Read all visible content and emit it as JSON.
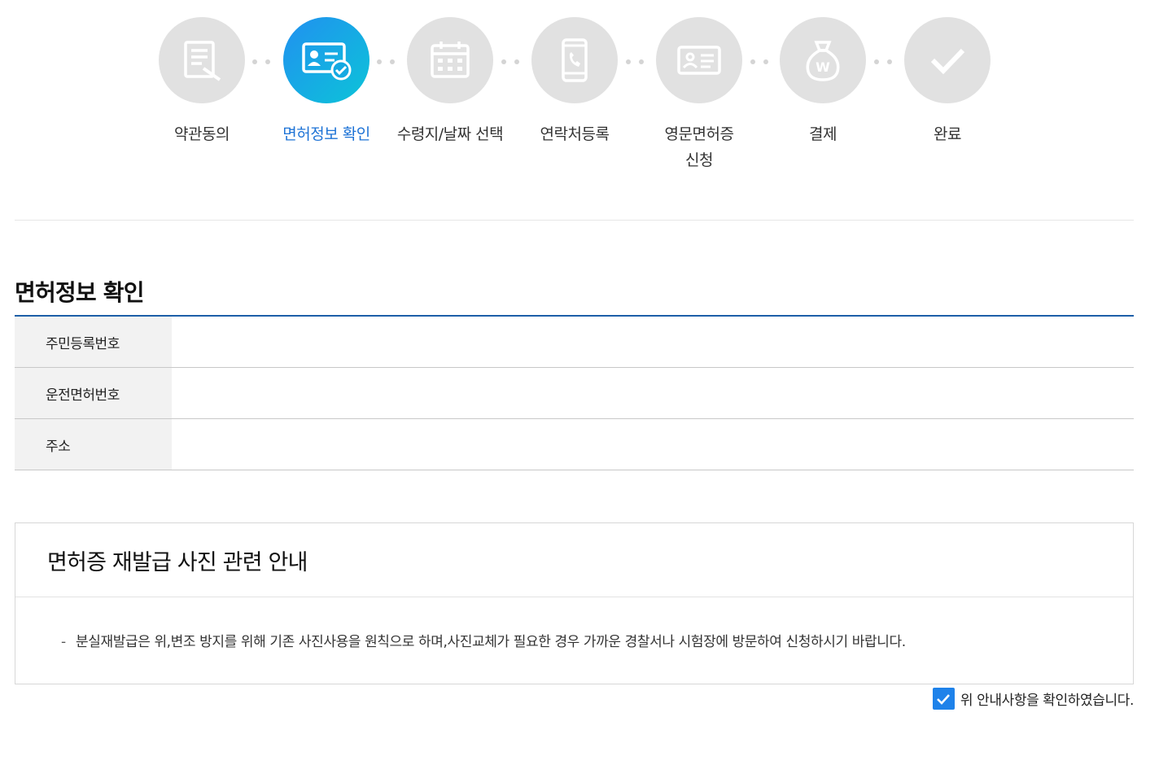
{
  "steps": [
    {
      "label": "약관동의",
      "icon": "document-sign-icon",
      "active": false
    },
    {
      "label": "면허정보 확인",
      "icon": "id-card-check-icon",
      "active": true
    },
    {
      "label": "수령지/날짜 선택",
      "icon": "calendar-icon",
      "active": false
    },
    {
      "label": "연락처등록",
      "icon": "phone-icon",
      "active": false
    },
    {
      "label": "영문면허증\n신청",
      "icon": "license-card-icon",
      "active": false
    },
    {
      "label": "결제",
      "icon": "money-bag-icon",
      "active": false
    },
    {
      "label": "완료",
      "icon": "checkmark-icon",
      "active": false
    }
  ],
  "section": {
    "title": "면허정보 확인"
  },
  "info_table": {
    "rows": [
      {
        "label": "주민등록번호",
        "value": ""
      },
      {
        "label": "운전면허번호",
        "value": ""
      },
      {
        "label": "주소",
        "value": ""
      }
    ]
  },
  "notice": {
    "title": "면허증 재발급 사진 관련 안내",
    "bullet": "-",
    "text": "분실재발급은 위,변조 방지를 위해 기존 사진사용을 원칙으로 하며,사진교체가 필요한 경우 가까운 경찰서나 시험장에 방문하여 신청하시기 바랍니다."
  },
  "confirm": {
    "label": "위 안내사항을 확인하였습니다.",
    "checked": true
  },
  "colors": {
    "accent": "#1e73d6",
    "table_border": "#1d5fa8",
    "step_inactive": "#e1e1e1"
  }
}
